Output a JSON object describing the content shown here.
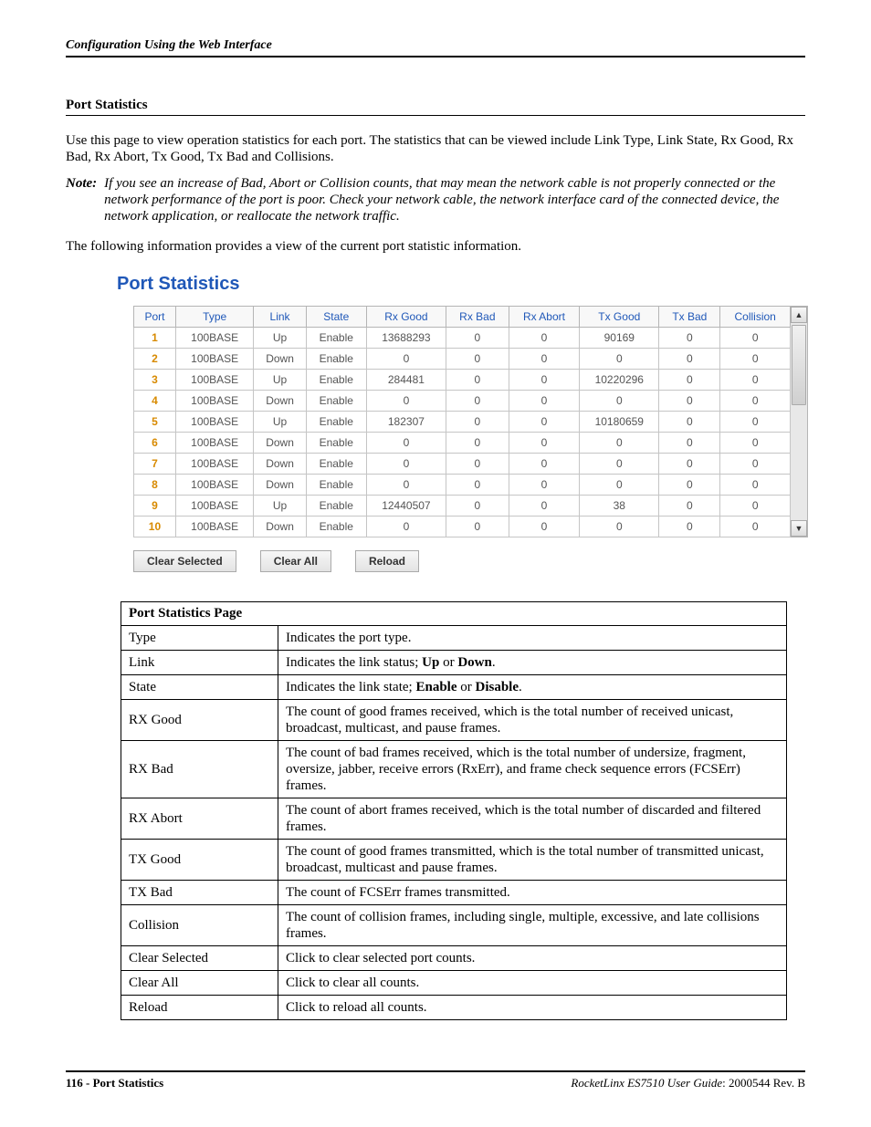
{
  "header": {
    "chapter": "Configuration Using the Web Interface"
  },
  "section": {
    "title": "Port Statistics",
    "intro": "Use this page to view operation statistics for each port. The statistics that can be viewed include Link Type, Link State, Rx Good, Rx Bad, Rx Abort, Tx Good, Tx Bad and Collisions.",
    "note_label": "Note:",
    "note_text": "If you see an increase of Bad, Abort or Collision counts, that may mean the network cable is not properly connected or the network performance of the port is poor. Check your network cable, the network interface card of the connected device, the network application, or reallocate the network traffic.",
    "following": "The following information provides a view of the current port statistic information."
  },
  "panel": {
    "title": "Port Statistics",
    "columns": [
      "Port",
      "Type",
      "Link",
      "State",
      "Rx Good",
      "Rx Bad",
      "Rx Abort",
      "Tx Good",
      "Tx Bad",
      "Collision"
    ],
    "rows": [
      {
        "port": "1",
        "type": "100BASE",
        "link": "Up",
        "state": "Enable",
        "rx_good": "13688293",
        "rx_bad": "0",
        "rx_abort": "0",
        "tx_good": "90169",
        "tx_bad": "0",
        "collision": "0"
      },
      {
        "port": "2",
        "type": "100BASE",
        "link": "Down",
        "state": "Enable",
        "rx_good": "0",
        "rx_bad": "0",
        "rx_abort": "0",
        "tx_good": "0",
        "tx_bad": "0",
        "collision": "0"
      },
      {
        "port": "3",
        "type": "100BASE",
        "link": "Up",
        "state": "Enable",
        "rx_good": "284481",
        "rx_bad": "0",
        "rx_abort": "0",
        "tx_good": "10220296",
        "tx_bad": "0",
        "collision": "0"
      },
      {
        "port": "4",
        "type": "100BASE",
        "link": "Down",
        "state": "Enable",
        "rx_good": "0",
        "rx_bad": "0",
        "rx_abort": "0",
        "tx_good": "0",
        "tx_bad": "0",
        "collision": "0"
      },
      {
        "port": "5",
        "type": "100BASE",
        "link": "Up",
        "state": "Enable",
        "rx_good": "182307",
        "rx_bad": "0",
        "rx_abort": "0",
        "tx_good": "10180659",
        "tx_bad": "0",
        "collision": "0"
      },
      {
        "port": "6",
        "type": "100BASE",
        "link": "Down",
        "state": "Enable",
        "rx_good": "0",
        "rx_bad": "0",
        "rx_abort": "0",
        "tx_good": "0",
        "tx_bad": "0",
        "collision": "0"
      },
      {
        "port": "7",
        "type": "100BASE",
        "link": "Down",
        "state": "Enable",
        "rx_good": "0",
        "rx_bad": "0",
        "rx_abort": "0",
        "tx_good": "0",
        "tx_bad": "0",
        "collision": "0"
      },
      {
        "port": "8",
        "type": "100BASE",
        "link": "Down",
        "state": "Enable",
        "rx_good": "0",
        "rx_bad": "0",
        "rx_abort": "0",
        "tx_good": "0",
        "tx_bad": "0",
        "collision": "0"
      },
      {
        "port": "9",
        "type": "100BASE",
        "link": "Up",
        "state": "Enable",
        "rx_good": "12440507",
        "rx_bad": "0",
        "rx_abort": "0",
        "tx_good": "38",
        "tx_bad": "0",
        "collision": "0"
      },
      {
        "port": "10",
        "type": "100BASE",
        "link": "Down",
        "state": "Enable",
        "rx_good": "0",
        "rx_bad": "0",
        "rx_abort": "0",
        "tx_good": "0",
        "tx_bad": "0",
        "collision": "0"
      }
    ],
    "buttons": {
      "clear_selected": "Clear Selected",
      "clear_all": "Clear All",
      "reload": "Reload"
    }
  },
  "definitions": {
    "title": "Port Statistics Page",
    "rows": [
      {
        "term": "Type",
        "desc_parts": [
          {
            "t": "Indicates the port type."
          }
        ]
      },
      {
        "term": "Link",
        "desc_parts": [
          {
            "t": "Indicates the link status; "
          },
          {
            "t": "Up",
            "b": true
          },
          {
            "t": " or "
          },
          {
            "t": "Down",
            "b": true
          },
          {
            "t": "."
          }
        ]
      },
      {
        "term": "State",
        "desc_parts": [
          {
            "t": "Indicates the link state; "
          },
          {
            "t": "Enable",
            "b": true
          },
          {
            "t": " or "
          },
          {
            "t": "Disable",
            "b": true
          },
          {
            "t": "."
          }
        ]
      },
      {
        "term": "RX Good",
        "desc_parts": [
          {
            "t": "The count of good frames received, which is the total number of received unicast, broadcast, multicast, and pause frames."
          }
        ]
      },
      {
        "term": "RX Bad",
        "desc_parts": [
          {
            "t": "The count of bad frames received, which is the total number of undersize, fragment, oversize, jabber, receive errors (RxErr), and frame check sequence errors (FCSErr) frames."
          }
        ]
      },
      {
        "term": "RX Abort",
        "desc_parts": [
          {
            "t": "The count of abort frames received, which is the total number of discarded and filtered frames."
          }
        ]
      },
      {
        "term": "TX Good",
        "desc_parts": [
          {
            "t": "The count of good frames transmitted, which is the total number of transmitted unicast, broadcast, multicast and pause frames."
          }
        ]
      },
      {
        "term": "TX Bad",
        "desc_parts": [
          {
            "t": "The count of FCSErr frames transmitted."
          }
        ]
      },
      {
        "term": "Collision",
        "desc_parts": [
          {
            "t": "The count of collision frames, including single, multiple, excessive, and late collisions frames."
          }
        ]
      },
      {
        "term": "Clear Selected",
        "desc_parts": [
          {
            "t": "Click to clear selected port counts."
          }
        ]
      },
      {
        "term": "Clear All",
        "desc_parts": [
          {
            "t": "Click to clear all counts."
          }
        ]
      },
      {
        "term": "Reload",
        "desc_parts": [
          {
            "t": "Click to reload all counts."
          }
        ]
      }
    ]
  },
  "footer": {
    "left": "116 - Port Statistics",
    "right_prefix": "RocketLinx ES7510  User Guide",
    "right_suffix": ": 2000544 Rev. B"
  }
}
